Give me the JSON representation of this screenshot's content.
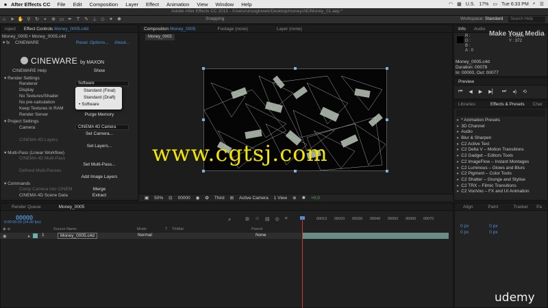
{
  "menubar": {
    "apple": "",
    "app": "After Effects CC",
    "items": [
      "File",
      "Edit",
      "Composition",
      "Layer",
      "Effect",
      "Animation",
      "View",
      "Window",
      "Help"
    ],
    "country": "U.S.",
    "battery": "17%",
    "clock": "Tue 6:33 PM"
  },
  "titlebar": {
    "title": "Adobe After Effects CC 2015 - /Users/urisoglowek/Desktop/money/AE/Money_01.aep *"
  },
  "toolbar": {
    "snapping": "Snapping",
    "workspace_label": "Workspace:",
    "workspace": "Standard",
    "search": "Search Help"
  },
  "effect_controls": {
    "tab_project": "roject",
    "tab_label": "Effect Controls",
    "tab_file": "Money_0005.c4d",
    "breadcrumb": "Money_0005 • Money_0005.c4d",
    "effect": "CINEWARE",
    "reset": "Reset",
    "options": "Options...",
    "about": "About...",
    "logo": "CINEWARE",
    "logo_by": "by MAXON",
    "help_label": "CINEWARE Help",
    "show": "Show",
    "render_settings": "Render Settings",
    "renderer": "Renderer",
    "renderer_value": "Software",
    "display": "Display",
    "no_textures": "No Textures/Shader",
    "no_precalc": "No pre-calculation",
    "keep_textures": "Keep Textures in RAM",
    "render_server": "Render Server",
    "purge": "Purge Memory",
    "project_settings": "Project Settings",
    "camera": "Camera",
    "camera_value": "CINEMA 4D Camera",
    "set_camera": "Set Camera...",
    "c4d_layers": "CINEMA 4D Layers",
    "set_layers": "Set Layers...",
    "multipass": "Multi-Pass (Linear Workflow)",
    "c4d_multipass": "CINEMA 4D Multi-Pass",
    "set_multipass": "Set Multi-Pass...",
    "defined_multipasses": "Defined Multi-Passes",
    "add_image_layers": "Add Image Layers",
    "commands": "Commands",
    "comp_camera": "Comp Camera into CINEM",
    "merge": "Merge",
    "scene_data": "CINEMA 4D Scene Data",
    "extract": "Extract",
    "popup_options": [
      "Standard (Final)",
      "Standard (Draft)",
      "Software"
    ],
    "popup_selected": "Software"
  },
  "composition": {
    "tab_label": "Composition",
    "tab_file": "Money_0005",
    "footage_tab": "Footage (none)",
    "layer_tab": "Layer (none)",
    "chip": "Money_0005",
    "zoom": "50%",
    "timecode": "00000",
    "resolution": "Third",
    "camera": "Active Camera",
    "view": "1 View",
    "exposure": "+0.0"
  },
  "info": {
    "tab_info": "Info",
    "tab_audio": "Audio",
    "r": "R :",
    "g": "G :",
    "b": "B :",
    "a": "A : 0",
    "x": "X : 1196",
    "y": "Y : 372",
    "file": "Money_0005.c4d",
    "duration": "Duration: 00078",
    "inout": "In: 00000, Out: 00077"
  },
  "preview": {
    "tab": "Preview"
  },
  "effects_presets": {
    "tab_libraries": "Libraries",
    "tab_effects": "Effects & Presets",
    "tab_more": "Char",
    "items": [
      "* Animation Presets",
      "3D Channel",
      "Audio",
      "Blur & Sharpen",
      "C2 Active Text",
      "C2 Delta V – Motion Transitions",
      "C2 Gadget – Editors Tools",
      "C2 ImageFlow – Instant Montages",
      "C2 Luminous – Glows and Blurs",
      "C2 Pigment – Color Tools",
      "C2 Shatter – Grunge and Stylise",
      "C2 TRX – Filmic Transitions",
      "C2 VooVoo – FX and UI Animation"
    ]
  },
  "timeline": {
    "tab_render": "Render Queue",
    "tab_comp": "Money_0005",
    "time": "00000",
    "fps": "0:00:00:00 (24.00 fps)",
    "col_source": "Source Name",
    "col_mode": "Mode",
    "col_t": "T",
    "col_trkmat": "TrkMat",
    "col_parent": "Parent",
    "layer_num": "1",
    "layer_name": "Money_0005.c4d",
    "layer_mode": "Normal",
    "layer_parent": "None",
    "ruler": [
      "00010",
      "00020",
      "00030",
      "00040",
      "00050",
      "00060",
      "00070"
    ]
  },
  "align": {
    "tabs": [
      "Align",
      "Paint",
      "Tracker",
      "Pa"
    ],
    "rows": [
      "0 px",
      "0 px",
      "0 px",
      "0 px"
    ]
  },
  "watermark": "www.cgtsj.com",
  "make_logo": "Make Your Media",
  "udemy": "udemy",
  "colors": {
    "accent_blue": "#4d93d9",
    "watermark_yellow": "#f2e600",
    "playhead_red": "#d43535",
    "track_teal": "#6a8c86"
  }
}
